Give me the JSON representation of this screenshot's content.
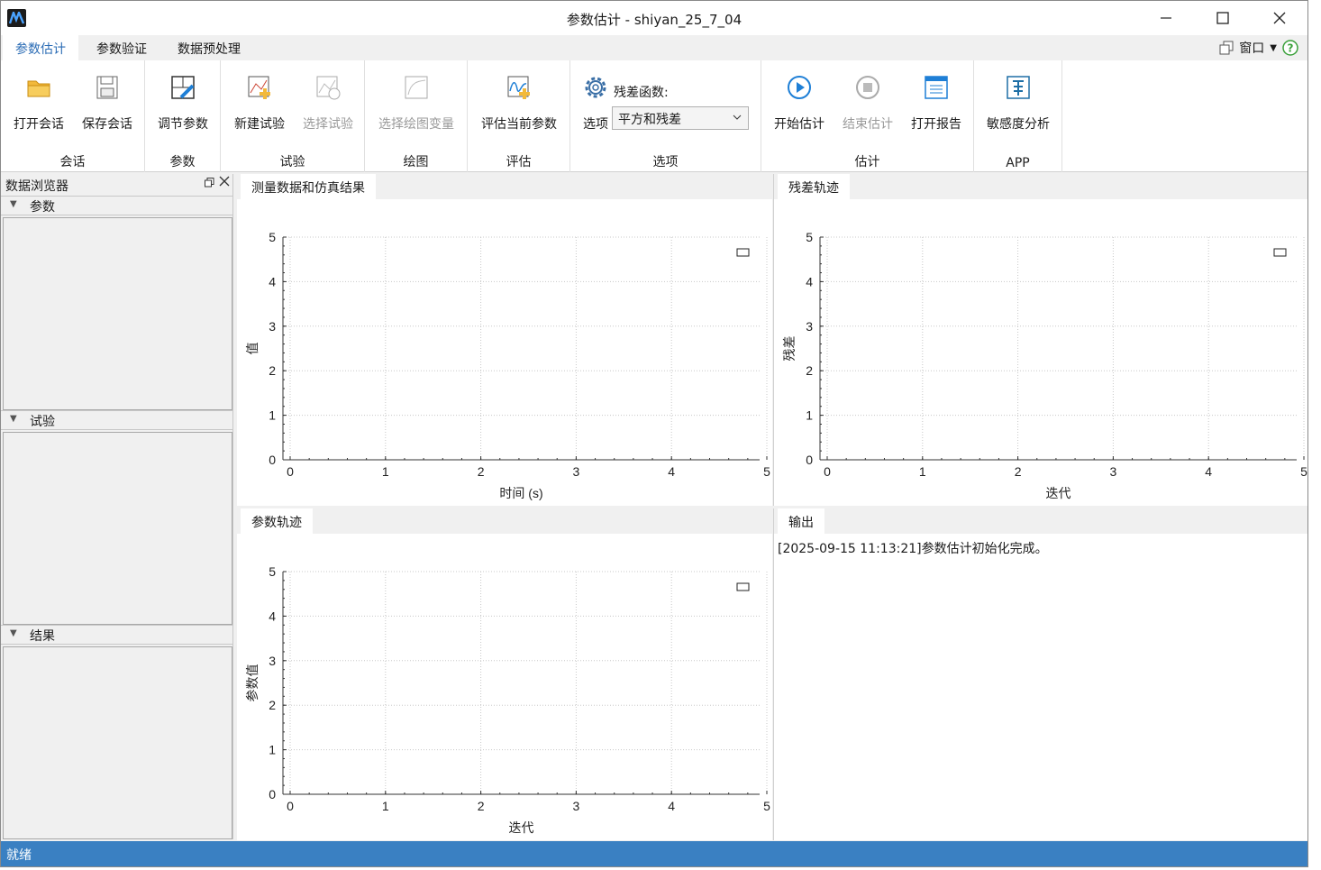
{
  "window": {
    "title": "参数估计 -  shiyan_25_7_04",
    "minimize_icon": "minimize-icon",
    "maximize_icon": "maximize-icon",
    "close_icon": "close-icon"
  },
  "menu": {
    "tabs": [
      "参数估计",
      "参数验证",
      "数据预处理"
    ],
    "active_tab": 0,
    "window_menu_label": "窗口"
  },
  "ribbon": {
    "groups": {
      "session": {
        "label": "会话",
        "open": "打开会话",
        "save": "保存会话"
      },
      "params": {
        "label": "参数",
        "tune": "调节参数"
      },
      "experiment": {
        "label": "试验",
        "new": "新建试验",
        "select": "选择试验"
      },
      "plot": {
        "label": "绘图",
        "select_vars": "选择绘图变量"
      },
      "evaluate": {
        "label": "评估",
        "eval_current": "评估当前参数"
      },
      "options": {
        "label": "选项",
        "options_btn": "选项",
        "residual_label": "残差函数:",
        "residual_value": "平方和残差"
      },
      "estimate": {
        "label": "估计",
        "start": "开始估计",
        "stop": "结束估计",
        "report": "打开报告"
      },
      "app": {
        "label": "APP",
        "sensitivity": "敏感度分析"
      }
    },
    "colors": {
      "accent": "#2b6cb5",
      "folder": "#f2b93b",
      "play": "#1e7fd6"
    }
  },
  "browser": {
    "title": "数据浏览器",
    "sections": [
      "参数",
      "试验",
      "结果"
    ]
  },
  "panes": {
    "measure": {
      "tab": "测量数据和仿真结果"
    },
    "residual": {
      "tab": "残差轨迹"
    },
    "param_trace": {
      "tab": "参数轨迹"
    },
    "output": {
      "tab": "输出",
      "log": "[2025-09-15 11:13:21]参数估计初始化完成。"
    }
  },
  "status": {
    "text": "就绪",
    "color": "#3a80c2"
  },
  "chart_data": [
    {
      "type": "line",
      "xlabel": "时间 (s)",
      "ylabel": "值",
      "xlim": [
        0,
        5
      ],
      "ylim": [
        0,
        5
      ],
      "xticks": [
        0,
        1,
        2,
        3,
        4,
        5
      ],
      "yticks": [
        0,
        1,
        2,
        3,
        4,
        5
      ],
      "grid": true,
      "legend": "top-right",
      "series": []
    },
    {
      "type": "line",
      "xlabel": "迭代",
      "ylabel": "残差",
      "xlim": [
        0,
        5
      ],
      "ylim": [
        0,
        5
      ],
      "xticks": [
        0,
        1,
        2,
        3,
        4,
        5
      ],
      "yticks": [
        0,
        1,
        2,
        3,
        4,
        5
      ],
      "grid": true,
      "legend": "top-right",
      "series": []
    },
    {
      "type": "line",
      "xlabel": "迭代",
      "ylabel": "参数值",
      "xlim": [
        0,
        5
      ],
      "ylim": [
        0,
        5
      ],
      "xticks": [
        0,
        1,
        2,
        3,
        4,
        5
      ],
      "yticks": [
        0,
        1,
        2,
        3,
        4,
        5
      ],
      "grid": true,
      "legend": "top-right",
      "series": []
    }
  ]
}
